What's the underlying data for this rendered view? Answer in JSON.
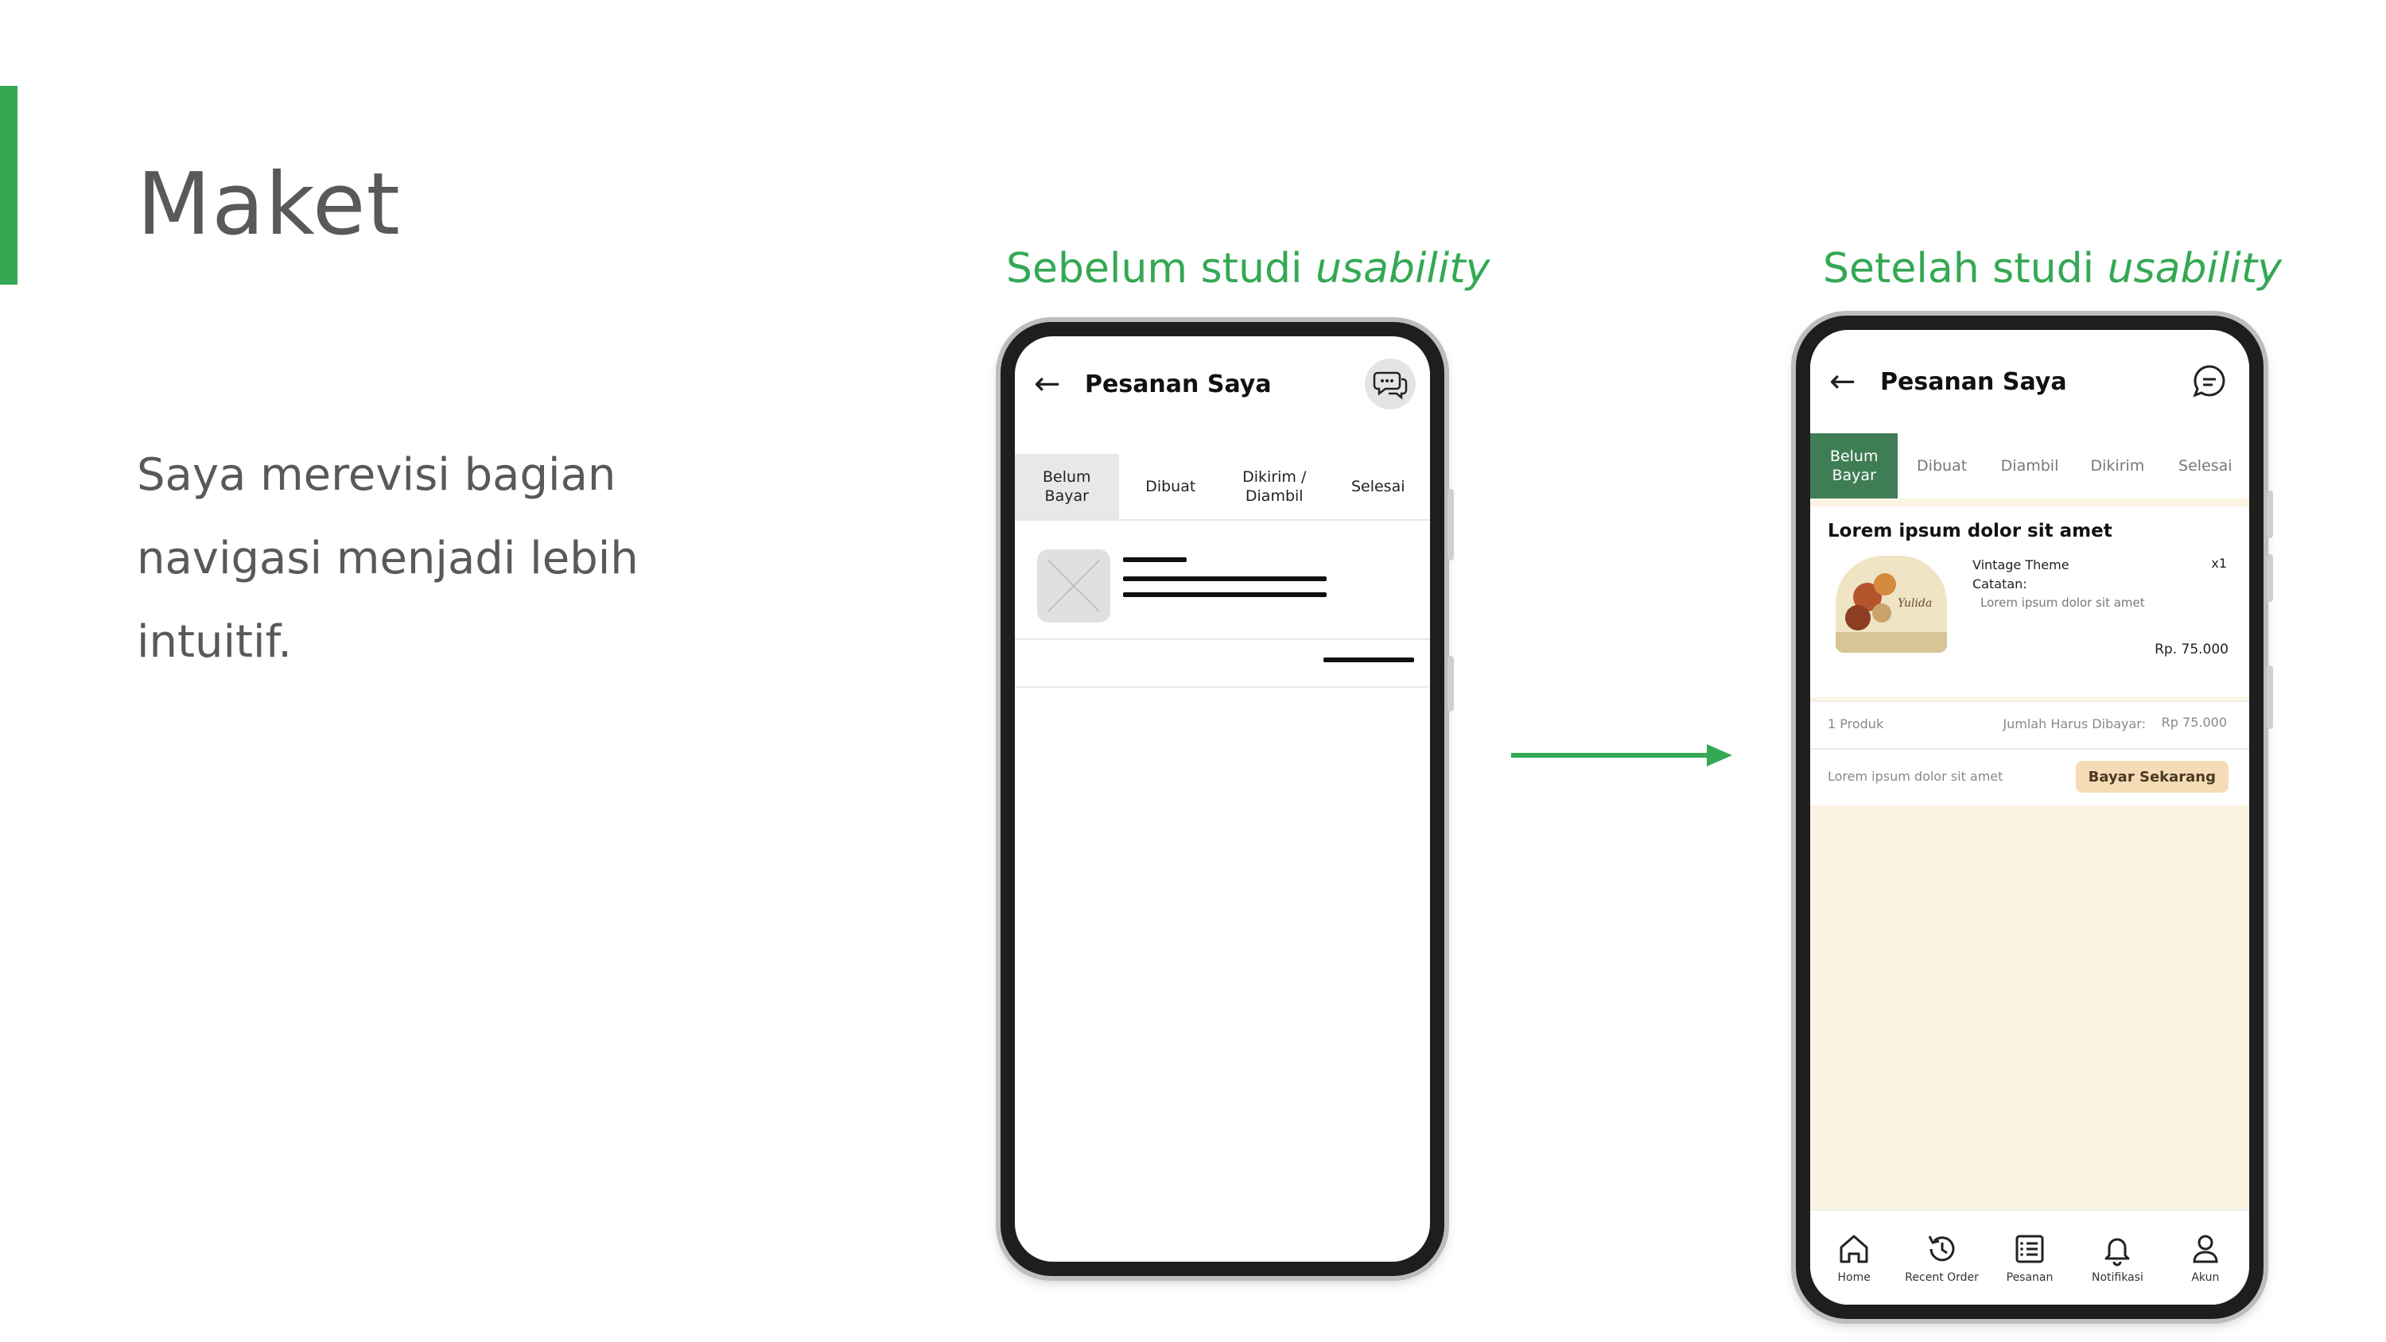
{
  "slide": {
    "title": "Maket",
    "body": "Saya merevisi bagian navigasi menjadi lebih intuitif."
  },
  "captions": {
    "before_prefix": "Sebelum studi ",
    "before_em": "usability",
    "after_prefix": "Setelah studi ",
    "after_em": "usability"
  },
  "before": {
    "header_title": "Pesanan Saya",
    "tabs": [
      "Belum\nBayar",
      "Dibuat",
      "Dikirim /\nDiambil",
      "Selesai"
    ]
  },
  "after": {
    "header_title": "Pesanan Saya",
    "tabs": [
      "Belum\nBayar",
      "Dibuat",
      "Diambil",
      "Dikirim",
      "Selesai"
    ],
    "order": {
      "title": "Lorem ipsum dolor sit amet",
      "product_name": "Vintage Theme",
      "note_label": "Catatan:",
      "note_text": "Lorem ipsum dolor sit amet",
      "qty": "x1",
      "price": "Rp. 75.000",
      "count": "1 Produk",
      "total_label": "Jumlah Harus Dibayar:",
      "total_value": "Rp 75.000",
      "footer_text": "Lorem ipsum dolor sit amet",
      "pay_button": "Bayar Sekarang"
    },
    "nav": [
      {
        "label": "Home",
        "icon": "home-icon"
      },
      {
        "label": "Recent Order",
        "icon": "history-icon"
      },
      {
        "label": "Pesanan",
        "icon": "list-icon"
      },
      {
        "label": "Notifikasi",
        "icon": "bell-icon"
      },
      {
        "label": "Akun",
        "icon": "user-icon"
      }
    ]
  },
  "colors": {
    "accent": "#34a853",
    "active_tab": "#3f7d55",
    "cream_bg": "#fbf4e2",
    "pay_button": "#f5dcb6"
  }
}
